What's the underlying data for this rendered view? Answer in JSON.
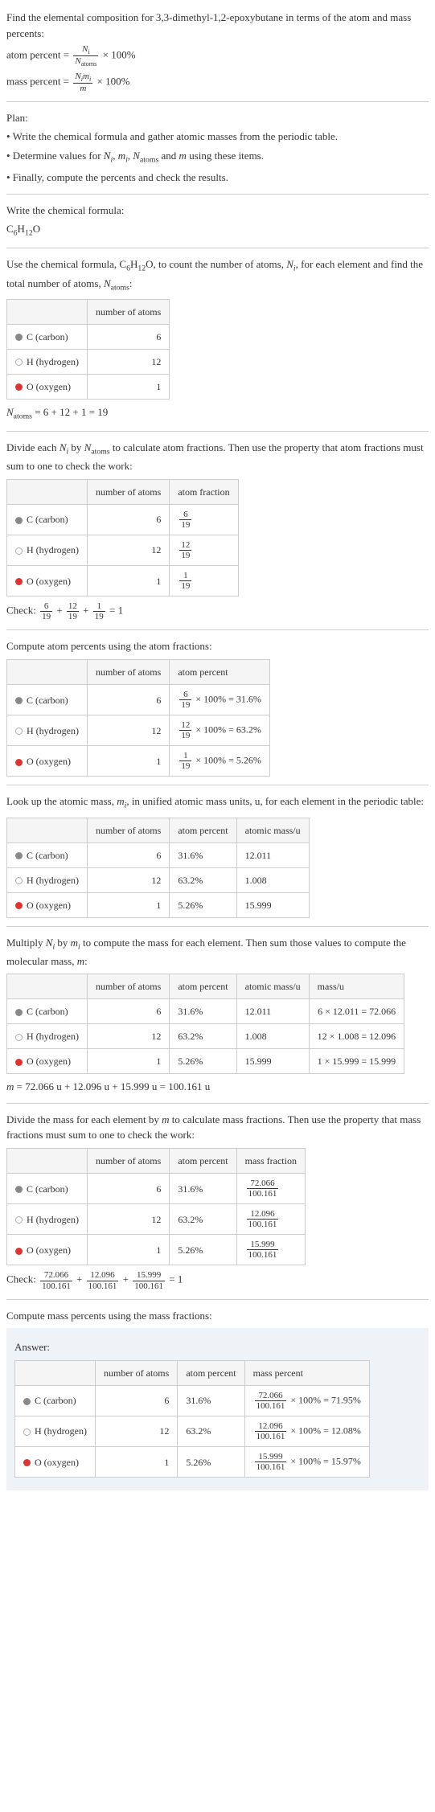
{
  "intro": {
    "line1": "Find the elemental composition for 3,3-dimethyl-1,2-epoxybutane in terms of the atom and mass percents:",
    "atom_formula_lhs": "atom percent = ",
    "atom_formula_num": "N",
    "atom_formula_num_sub": "i",
    "atom_formula_den": "N",
    "atom_formula_den_sub": "atoms",
    "atom_formula_tail": " × 100%",
    "mass_formula_lhs": "mass percent = ",
    "mass_formula_num": "N_i m_i",
    "mass_formula_den": "m",
    "mass_formula_tail": " × 100%"
  },
  "plan": {
    "header": "Plan:",
    "b1": "• Write the chemical formula and gather atomic masses from the periodic table.",
    "b2_a": "• Determine values for ",
    "b2_vars": "N_i, m_i, N_atoms",
    "b2_b": " and ",
    "b2_m": "m",
    "b2_c": " using these items.",
    "b3": "• Finally, compute the percents and check the results."
  },
  "s1": {
    "header": "Write the chemical formula:",
    "formula": "C_6H_12O"
  },
  "s2": {
    "line_a": "Use the chemical formula, ",
    "line_formula": "C_6H_12O",
    "line_b": ", to count the number of atoms, ",
    "line_ni": "N_i",
    "line_c": ", for each element and find the total number of atoms, ",
    "line_na": "N_atoms",
    "line_d": ":",
    "th_blank": "",
    "th_num": "number of atoms",
    "rows": [
      {
        "sw": "sw-c",
        "el": "C (carbon)",
        "n": "6"
      },
      {
        "sw": "sw-h",
        "el": "H (hydrogen)",
        "n": "12"
      },
      {
        "sw": "sw-o",
        "el": "O (oxygen)",
        "n": "1"
      }
    ],
    "sum_a": "N",
    "sum_sub": "atoms",
    "sum_b": " = 6 + 12 + 1 = 19"
  },
  "s3": {
    "line_a": "Divide each ",
    "line_ni": "N_i",
    "line_b": " by ",
    "line_na": "N_atoms",
    "line_c": " to calculate atom fractions. Then use the property that atom fractions must sum to one to check the work:",
    "th_num": "number of atoms",
    "th_frac": "atom fraction",
    "rows": [
      {
        "sw": "sw-c",
        "el": "C (carbon)",
        "n": "6",
        "fn": "6",
        "fd": "19"
      },
      {
        "sw": "sw-h",
        "el": "H (hydrogen)",
        "n": "12",
        "fn": "12",
        "fd": "19"
      },
      {
        "sw": "sw-o",
        "el": "O (oxygen)",
        "n": "1",
        "fn": "1",
        "fd": "19"
      }
    ],
    "check": "Check: ",
    "plus": " + ",
    "eq": " = 1"
  },
  "s4": {
    "line": "Compute atom percents using the atom fractions:",
    "th_num": "number of atoms",
    "th_pct": "atom percent",
    "rows": [
      {
        "sw": "sw-c",
        "el": "C (carbon)",
        "n": "6",
        "fn": "6",
        "fd": "19",
        "res": " × 100% = 31.6%"
      },
      {
        "sw": "sw-h",
        "el": "H (hydrogen)",
        "n": "12",
        "fn": "12",
        "fd": "19",
        "res": " × 100% = 63.2%"
      },
      {
        "sw": "sw-o",
        "el": "O (oxygen)",
        "n": "1",
        "fn": "1",
        "fd": "19",
        "res": " × 100% = 5.26%"
      }
    ]
  },
  "s5": {
    "line_a": "Look up the atomic mass, ",
    "line_mi": "m_i",
    "line_b": ", in unified atomic mass units, u, for each element in the periodic table:",
    "th_num": "number of atoms",
    "th_pct": "atom percent",
    "th_mass": "atomic mass/u",
    "rows": [
      {
        "sw": "sw-c",
        "el": "C (carbon)",
        "n": "6",
        "p": "31.6%",
        "m": "12.011"
      },
      {
        "sw": "sw-h",
        "el": "H (hydrogen)",
        "n": "12",
        "p": "63.2%",
        "m": "1.008"
      },
      {
        "sw": "sw-o",
        "el": "O (oxygen)",
        "n": "1",
        "p": "5.26%",
        "m": "15.999"
      }
    ]
  },
  "s6": {
    "line_a": "Multiply ",
    "line_ni": "N_i",
    "line_b": " by ",
    "line_mi": "m_i",
    "line_c": " to compute the mass for each element. Then sum those values to compute the molecular mass, ",
    "line_m": "m",
    "line_d": ":",
    "th_num": "number of atoms",
    "th_pct": "atom percent",
    "th_mass": "atomic mass/u",
    "th_massu": "mass/u",
    "rows": [
      {
        "sw": "sw-c",
        "el": "C (carbon)",
        "n": "6",
        "p": "31.6%",
        "m": "12.011",
        "calc": "6 × 12.011 = 72.066"
      },
      {
        "sw": "sw-h",
        "el": "H (hydrogen)",
        "n": "12",
        "p": "63.2%",
        "m": "1.008",
        "calc": "12 × 1.008 = 12.096"
      },
      {
        "sw": "sw-o",
        "el": "O (oxygen)",
        "n": "1",
        "p": "5.26%",
        "m": "15.999",
        "calc": "1 × 15.999 = 15.999"
      }
    ],
    "sum": "m = 72.066 u + 12.096 u + 15.999 u = 100.161 u"
  },
  "s7": {
    "line_a": "Divide the mass for each element by ",
    "line_m": "m",
    "line_b": " to calculate mass fractions. Then use the property that mass fractions must sum to one to check the work:",
    "th_num": "number of atoms",
    "th_pct": "atom percent",
    "th_frac": "mass fraction",
    "rows": [
      {
        "sw": "sw-c",
        "el": "C (carbon)",
        "n": "6",
        "p": "31.6%",
        "fn": "72.066",
        "fd": "100.161"
      },
      {
        "sw": "sw-h",
        "el": "H (hydrogen)",
        "n": "12",
        "p": "63.2%",
        "fn": "12.096",
        "fd": "100.161"
      },
      {
        "sw": "sw-o",
        "el": "O (oxygen)",
        "n": "1",
        "p": "5.26%",
        "fn": "15.999",
        "fd": "100.161"
      }
    ],
    "check": "Check: ",
    "plus": " + ",
    "eq": " = 1"
  },
  "s8": {
    "line": "Compute mass percents using the mass fractions:",
    "answer": "Answer:",
    "th_num": "number of atoms",
    "th_pct": "atom percent",
    "th_mpct": "mass percent",
    "rows": [
      {
        "sw": "sw-c",
        "el": "C (carbon)",
        "n": "6",
        "p": "31.6%",
        "fn": "72.066",
        "fd": "100.161",
        "res": " × 100% = 71.95%"
      },
      {
        "sw": "sw-h",
        "el": "H (hydrogen)",
        "n": "12",
        "p": "63.2%",
        "fn": "12.096",
        "fd": "100.161",
        "res": " × 100% = 12.08%"
      },
      {
        "sw": "sw-o",
        "el": "O (oxygen)",
        "n": "1",
        "p": "5.26%",
        "fn": "15.999",
        "fd": "100.161",
        "res": " × 100% = 15.97%"
      }
    ]
  }
}
